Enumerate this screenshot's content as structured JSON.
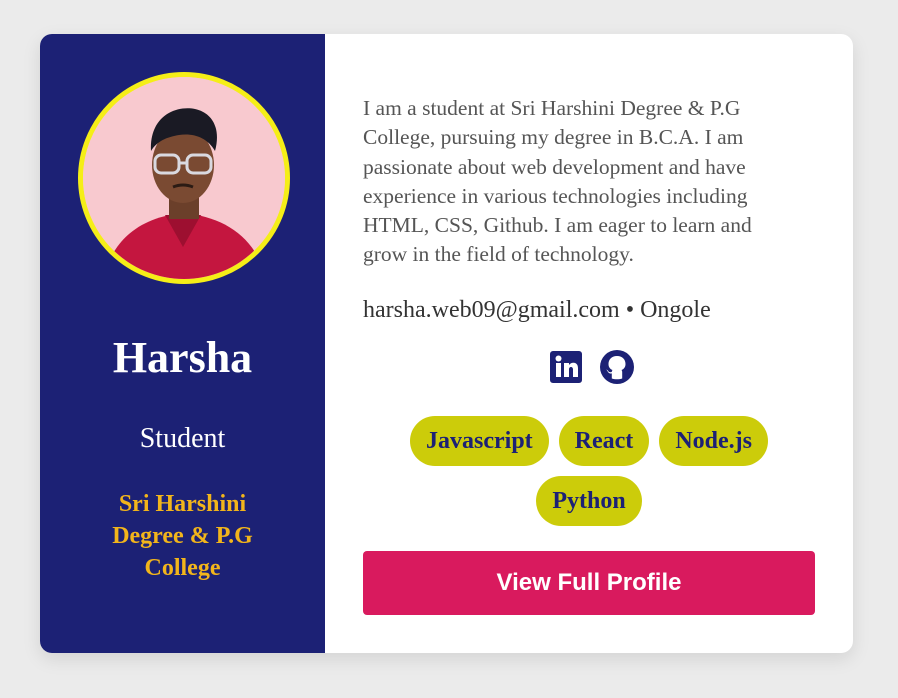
{
  "profile": {
    "name": "Harsha",
    "role": "Student",
    "college": "Sri Harshini Degree & P.G College",
    "bio": "I am a student at Sri Harshini Degree & P.G College, pursuing my degree in B.C.A. I am passionate about web development and have experience in various technologies including HTML, CSS, Github. I am eager to learn and grow in the field of technology.",
    "email": "harsha.web09@gmail.com",
    "separator": "•",
    "location": "Ongole",
    "contact_line": "harsha.web09@gmail.com • Ongole"
  },
  "socials": [
    {
      "icon": "linkedin-icon"
    },
    {
      "icon": "github-icon"
    }
  ],
  "skills": [
    "Javascript",
    "React",
    "Node.js",
    "Python"
  ],
  "cta": {
    "label": "View Full Profile"
  },
  "colors": {
    "page_bg": "#ebebeb",
    "sidebar_bg": "#1c2175",
    "avatar_ring": "#f5ee17",
    "college_text": "#f2b51b",
    "tag_bg": "#cccc0a",
    "tag_text": "#1c2175",
    "cta_bg": "#d91a5e"
  }
}
